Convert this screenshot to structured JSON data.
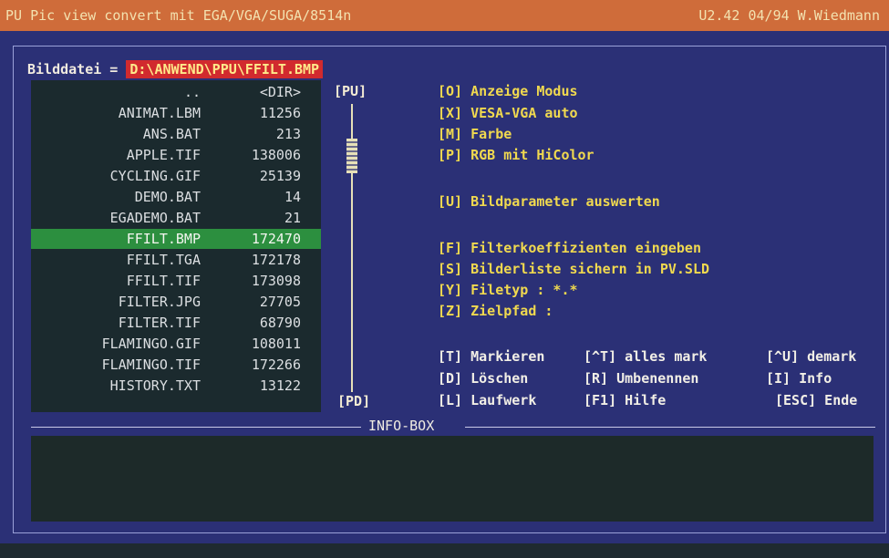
{
  "title": {
    "left": "PU Pic view convert mit EGA/VGA/SUGA/8514n",
    "right": "U2.42   04/94 W.Wiedmann"
  },
  "file_field": {
    "label": "Bilddatei = ",
    "value": "D:\\ANWEND\\PPU\\FFILT.BMP"
  },
  "scroll": {
    "up": "[PU]",
    "down": "[PD]"
  },
  "files": [
    {
      "name": "..",
      "size": "<DIR>"
    },
    {
      "name": "ANIMAT.LBM",
      "size": "11256"
    },
    {
      "name": "ANS.BAT",
      "size": "213"
    },
    {
      "name": "APPLE.TIF",
      "size": "138006"
    },
    {
      "name": "CYCLING.GIF",
      "size": "25139"
    },
    {
      "name": "DEMO.BAT",
      "size": "14"
    },
    {
      "name": "EGADEMO.BAT",
      "size": "21"
    },
    {
      "name": "FFILT.BMP",
      "size": "172470"
    },
    {
      "name": "FFILT.TGA",
      "size": "172178"
    },
    {
      "name": "FFILT.TIF",
      "size": "173098"
    },
    {
      "name": "FILTER.JPG",
      "size": "27705"
    },
    {
      "name": "FILTER.TIF",
      "size": "68790"
    },
    {
      "name": "FLAMINGO.GIF",
      "size": "108011"
    },
    {
      "name": "FLAMINGO.TIF",
      "size": "172266"
    },
    {
      "name": "HISTORY.TXT",
      "size": "13122"
    }
  ],
  "selected_index": 7,
  "menu": {
    "o": "[O] Anzeige Modus",
    "x": "[X] VESA-VGA auto",
    "m": "[M] Farbe",
    "p": "[P] RGB mit HiColor",
    "u": "[U] Bildparameter auswerten",
    "f": "[F] Filterkoeffizienten eingeben",
    "s": "[S] Bilderliste sichern in PV.SLD",
    "y": "[Y] Filetyp : *.*",
    "z": "[Z] Zielpfad :",
    "t": "[T] Markieren",
    "ctrl_t": "[^T] alles mark",
    "ctrl_u": "[^U] demark",
    "d": "[D] Löschen",
    "r": "[R]  Umbenennen",
    "i": "[I]  Info",
    "l": "[L] Laufwerk",
    "f1": "[F1] Hilfe",
    "esc": "[ESC] Ende"
  },
  "info_box": {
    "title": "INFO-BOX"
  }
}
